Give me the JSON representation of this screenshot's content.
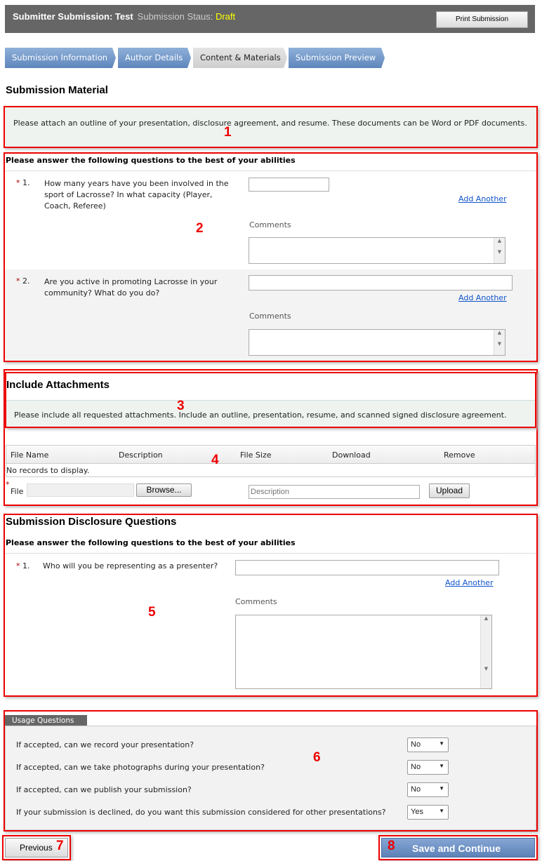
{
  "header": {
    "title": "Submitter Submission: Test",
    "status_label": "Submission Staus:",
    "status_value": "Draft",
    "print_button": "Print Submission"
  },
  "tabs": [
    {
      "label": "Submission Information",
      "active": false
    },
    {
      "label": "Author Details",
      "active": false
    },
    {
      "label": "Content & Materials",
      "active": true
    },
    {
      "label": "Submission Preview",
      "active": false
    }
  ],
  "page_title": "Submission Material",
  "intro": "Please attach an outline of your presentation, disclosure agreement, and resume.  These documents can be Word or PDF documents.",
  "questions": {
    "header": "Please answer the following questions to the best of your abilities",
    "items": [
      {
        "num": "1.",
        "text": "How many years have you been involved in the sport of Lacrosse? In what capacity (Player, Coach, Referee)",
        "value": "",
        "add_another": "Add Another",
        "comments_label": "Comments"
      },
      {
        "num": "2.",
        "text": "Are you active in promoting Lacrosse in your community? What do you do?",
        "value": "",
        "add_another": "Add Another",
        "comments_label": "Comments"
      }
    ]
  },
  "attachments": {
    "title": "Include Attachments",
    "note": "Please include all requested attachments.  Include an outline, presentation, resume, and scanned signed disclosure agreement.",
    "columns": [
      "File Name",
      "Description",
      "File Size",
      "Download",
      "Remove"
    ],
    "empty": "No records to display.",
    "file_label": "File",
    "browse": "Browse...",
    "description_placeholder": "Description",
    "upload": "Upload"
  },
  "disclosure": {
    "title": "Submission Disclosure Questions",
    "header": "Please answer the following questions to the best of your abilities",
    "items": [
      {
        "num": "1.",
        "text": "Who will you be representing as a presenter?",
        "value": "",
        "add_another": "Add Another",
        "comments_label": "Comments"
      }
    ]
  },
  "usage": {
    "tab": "Usage Questions",
    "items": [
      {
        "question": "If accepted, can we record your presentation?",
        "value": "No"
      },
      {
        "question": "If accepted, can we take photographs during your presentation?",
        "value": "No"
      },
      {
        "question": "If accepted, can we publish your submission?",
        "value": "No"
      },
      {
        "question": "If your submission is declined, do you want this submission considered for other presentations?",
        "value": "Yes"
      }
    ]
  },
  "footer": {
    "previous": "Previous",
    "save": "Save and Continue"
  },
  "annotations": [
    "1",
    "2",
    "3",
    "4",
    "5",
    "6",
    "7",
    "8"
  ],
  "colors": {
    "annotation": "#ee0000",
    "header_bg": "#666666",
    "status": "#ffff00",
    "tab_blue": "#6f94c6",
    "link": "#1155cc"
  }
}
